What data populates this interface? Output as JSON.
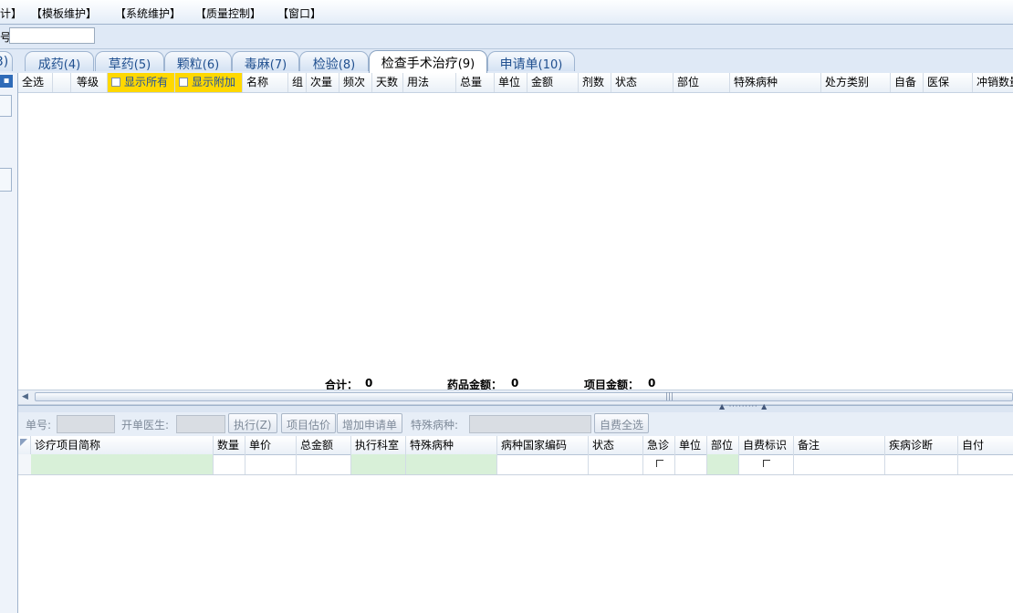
{
  "menu": {
    "items": [
      "计】",
      "【模板维护】",
      "【系统维护】",
      "【质量控制】",
      "【窗口】"
    ]
  },
  "search": {
    "label": "号",
    "value": ""
  },
  "tabs": [
    {
      "label": "3)",
      "active": false
    },
    {
      "label": "成药",
      "num": "(4)",
      "active": false
    },
    {
      "label": "草药",
      "num": "(5)",
      "active": false
    },
    {
      "label": "颗粒",
      "num": "(6)",
      "active": false
    },
    {
      "label": "毒麻",
      "num": "(7)",
      "active": false
    },
    {
      "label": "检验",
      "num": "(8)",
      "active": false
    },
    {
      "label": "检查手术治疗",
      "num": "(9)",
      "active": true
    },
    {
      "label": "申请单",
      "num": "(10)",
      "active": false
    }
  ],
  "upper_grid": {
    "columns": [
      "全选",
      "",
      "等级",
      "显示所有",
      "显示附加",
      "名称",
      "组",
      "次量",
      "频次",
      "天数",
      "用法",
      "总量",
      "单位",
      "金额",
      "剂数",
      "状态",
      "部位",
      "特殊病种",
      "处方类别",
      "自备",
      "医保",
      "冲销数量"
    ],
    "totals": {
      "sum_label": "合计：",
      "sum_value": "0",
      "drug_label": "药品金额：",
      "drug_value": "0",
      "item_label": "项目金额：",
      "item_value": "0"
    }
  },
  "lower_toolbar": {
    "order_no_label": "单号:",
    "doctor_label": "开单医生:",
    "execute_button": "执行(Z)",
    "estimate_button": "项目估价",
    "add_request_button": "增加申请单",
    "special_disease_label": "特殊病种:",
    "self_pay_all_button": "自费全选"
  },
  "lower_grid": {
    "columns": [
      "诊疗项目简称",
      "数量",
      "单价",
      "总金额",
      "执行科室",
      "特殊病种",
      "病种国家编码",
      "状态",
      "急诊",
      "单位",
      "部位",
      "自费标识",
      "备注",
      "疾病诊断",
      "自付"
    ]
  },
  "colors": {
    "highlight_yellow": "#ffd800",
    "editable_green": "#d8f0d8",
    "tab_text": "#1f4f8f"
  }
}
